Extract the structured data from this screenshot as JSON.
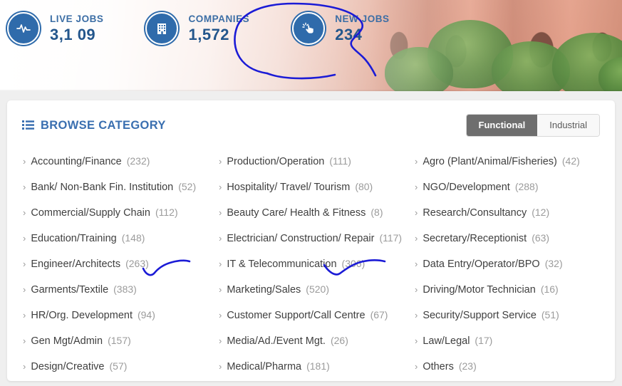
{
  "header": {
    "stats": [
      {
        "icon": "pulse-icon",
        "label": "LIVE JOBS",
        "value": "3,1 09"
      },
      {
        "icon": "building-icon",
        "label": "COMPANIES",
        "value": "1,572"
      },
      {
        "icon": "click-hand-icon",
        "label": "NEW JOBS",
        "value": "234"
      }
    ]
  },
  "browse": {
    "icon": "list-icon",
    "title": "BROWSE CATEGORY",
    "toggle": {
      "selected": "Functional",
      "options": [
        "Functional",
        "Industrial"
      ]
    },
    "columns": [
      [
        {
          "name": "Accounting/Finance",
          "count": "(232)"
        },
        {
          "name": "Bank/ Non-Bank Fin. Institution",
          "count": "(52)"
        },
        {
          "name": "Commercial/Supply Chain",
          "count": "(112)"
        },
        {
          "name": "Education/Training",
          "count": "(148)"
        },
        {
          "name": "Engineer/Architects",
          "count": "(263)"
        },
        {
          "name": "Garments/Textile",
          "count": "(383)"
        },
        {
          "name": "HR/Org. Development",
          "count": "(94)"
        },
        {
          "name": "Gen Mgt/Admin",
          "count": "(157)"
        },
        {
          "name": "Design/Creative",
          "count": "(57)"
        }
      ],
      [
        {
          "name": "Production/Operation",
          "count": "(111)"
        },
        {
          "name": "Hospitality/ Travel/ Tourism",
          "count": "(80)"
        },
        {
          "name": "Beauty Care/ Health & Fitness",
          "count": "(8)"
        },
        {
          "name": "Electrician/ Construction/ Repair",
          "count": "(117)"
        },
        {
          "name": "IT & Telecommunication",
          "count": "(306)"
        },
        {
          "name": "Marketing/Sales",
          "count": "(520)"
        },
        {
          "name": "Customer Support/Call Centre",
          "count": "(67)"
        },
        {
          "name": "Media/Ad./Event Mgt.",
          "count": "(26)"
        },
        {
          "name": "Medical/Pharma",
          "count": "(181)"
        }
      ],
      [
        {
          "name": "Agro (Plant/Animal/Fisheries)",
          "count": "(42)"
        },
        {
          "name": "NGO/Development",
          "count": "(288)"
        },
        {
          "name": "Research/Consultancy",
          "count": "(12)"
        },
        {
          "name": "Secretary/Receptionist",
          "count": "(63)"
        },
        {
          "name": "Data Entry/Operator/BPO",
          "count": "(32)"
        },
        {
          "name": "Driving/Motor Technician",
          "count": "(16)"
        },
        {
          "name": "Security/Support Service",
          "count": "(51)"
        },
        {
          "name": "Law/Legal",
          "count": "(17)"
        },
        {
          "name": "Others",
          "count": "(23)"
        }
      ]
    ]
  },
  "annotations": {
    "ink_color": "#1b1bd6",
    "marks": [
      {
        "name": "circle-around-new-jobs",
        "shape": "hand-drawn-ellipse"
      },
      {
        "name": "underline-garments-textile",
        "shape": "hand-drawn-check"
      },
      {
        "name": "underline-marketing-sales",
        "shape": "hand-drawn-check"
      }
    ]
  },
  "colors": {
    "brand_blue": "#3a6fb0",
    "stat_icon_blue": "#2f6bab",
    "stat_value_blue": "#23568c",
    "toggle_active_bg": "#6e6e6e",
    "page_bg": "#efefef",
    "card_bg": "#ffffff",
    "category_text": "#3f3f3f",
    "category_count": "#9b9b9b"
  }
}
